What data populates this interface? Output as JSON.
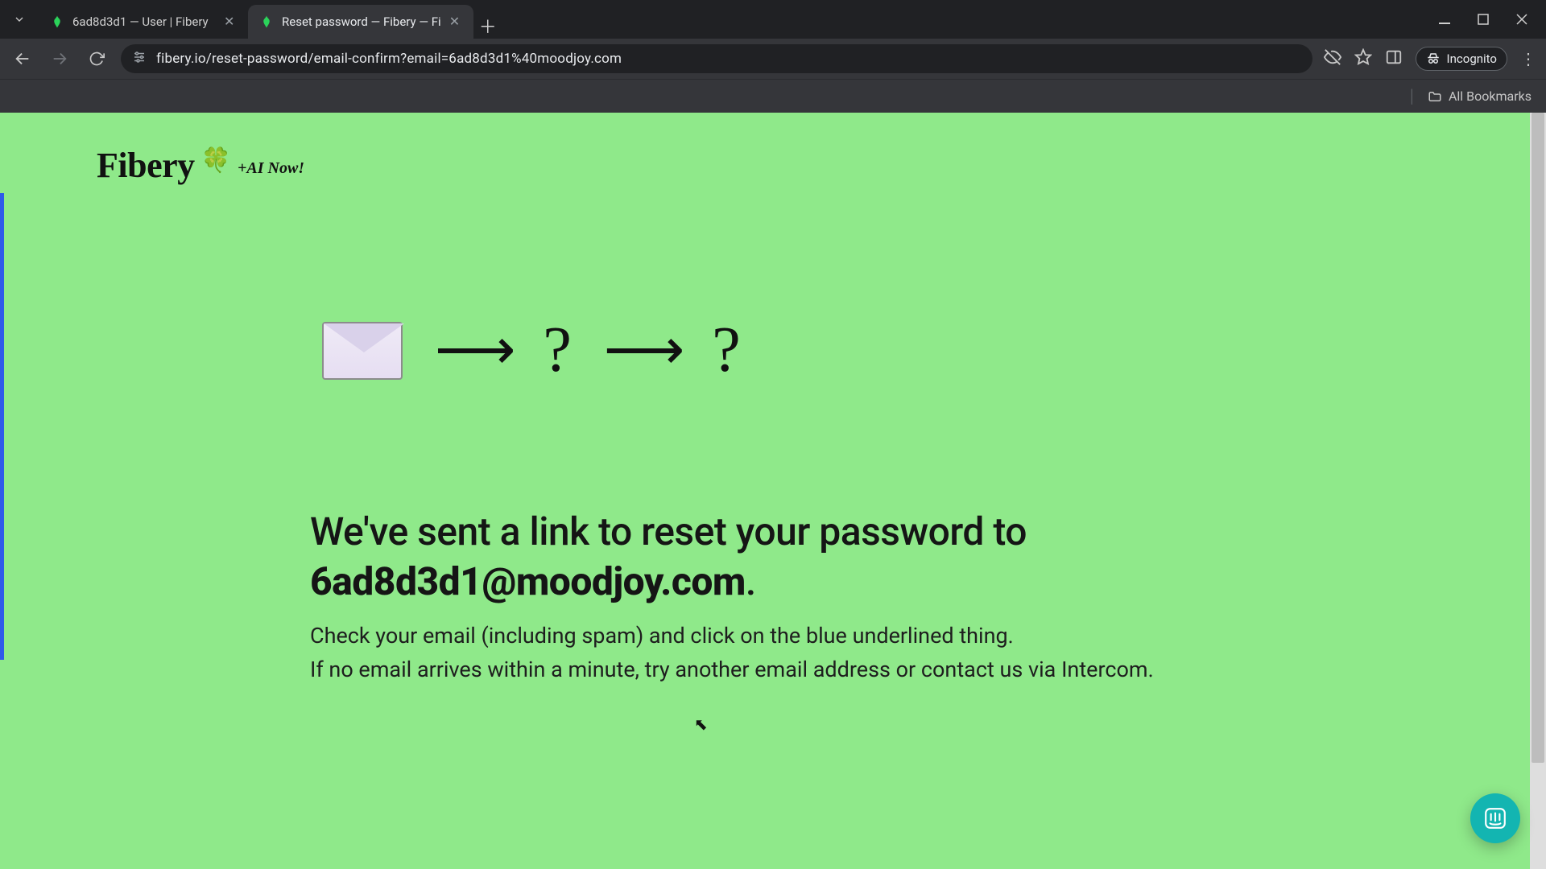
{
  "browser": {
    "tabs": [
      {
        "title": "6ad8d3d1 — User | Fibery",
        "active": false
      },
      {
        "title": "Reset password — Fibery — Fi",
        "active": true
      }
    ],
    "url": "fibery.io/reset-password/email-confirm?email=6ad8d3d1%40moodjoy.com",
    "incognito_label": "Incognito",
    "all_bookmarks_label": "All Bookmarks"
  },
  "page": {
    "logo_text": "Fibery",
    "logo_badge": "+AI Now!",
    "hero": {
      "arrow": "⟶",
      "qmark": "?"
    },
    "heading_prefix": "We've sent a link to reset your password to ",
    "email": "6ad8d3d1@moodjoy.com",
    "heading_suffix": ".",
    "body_line1": "Check your email (including spam) and click on the blue underlined thing.",
    "body_line2": "If no email arrives within a minute, try another email address or contact us via Intercom."
  },
  "colors": {
    "page_bg": "#8FE98A",
    "accent": "#2F5BEA",
    "intercom": "#13B5B1"
  }
}
